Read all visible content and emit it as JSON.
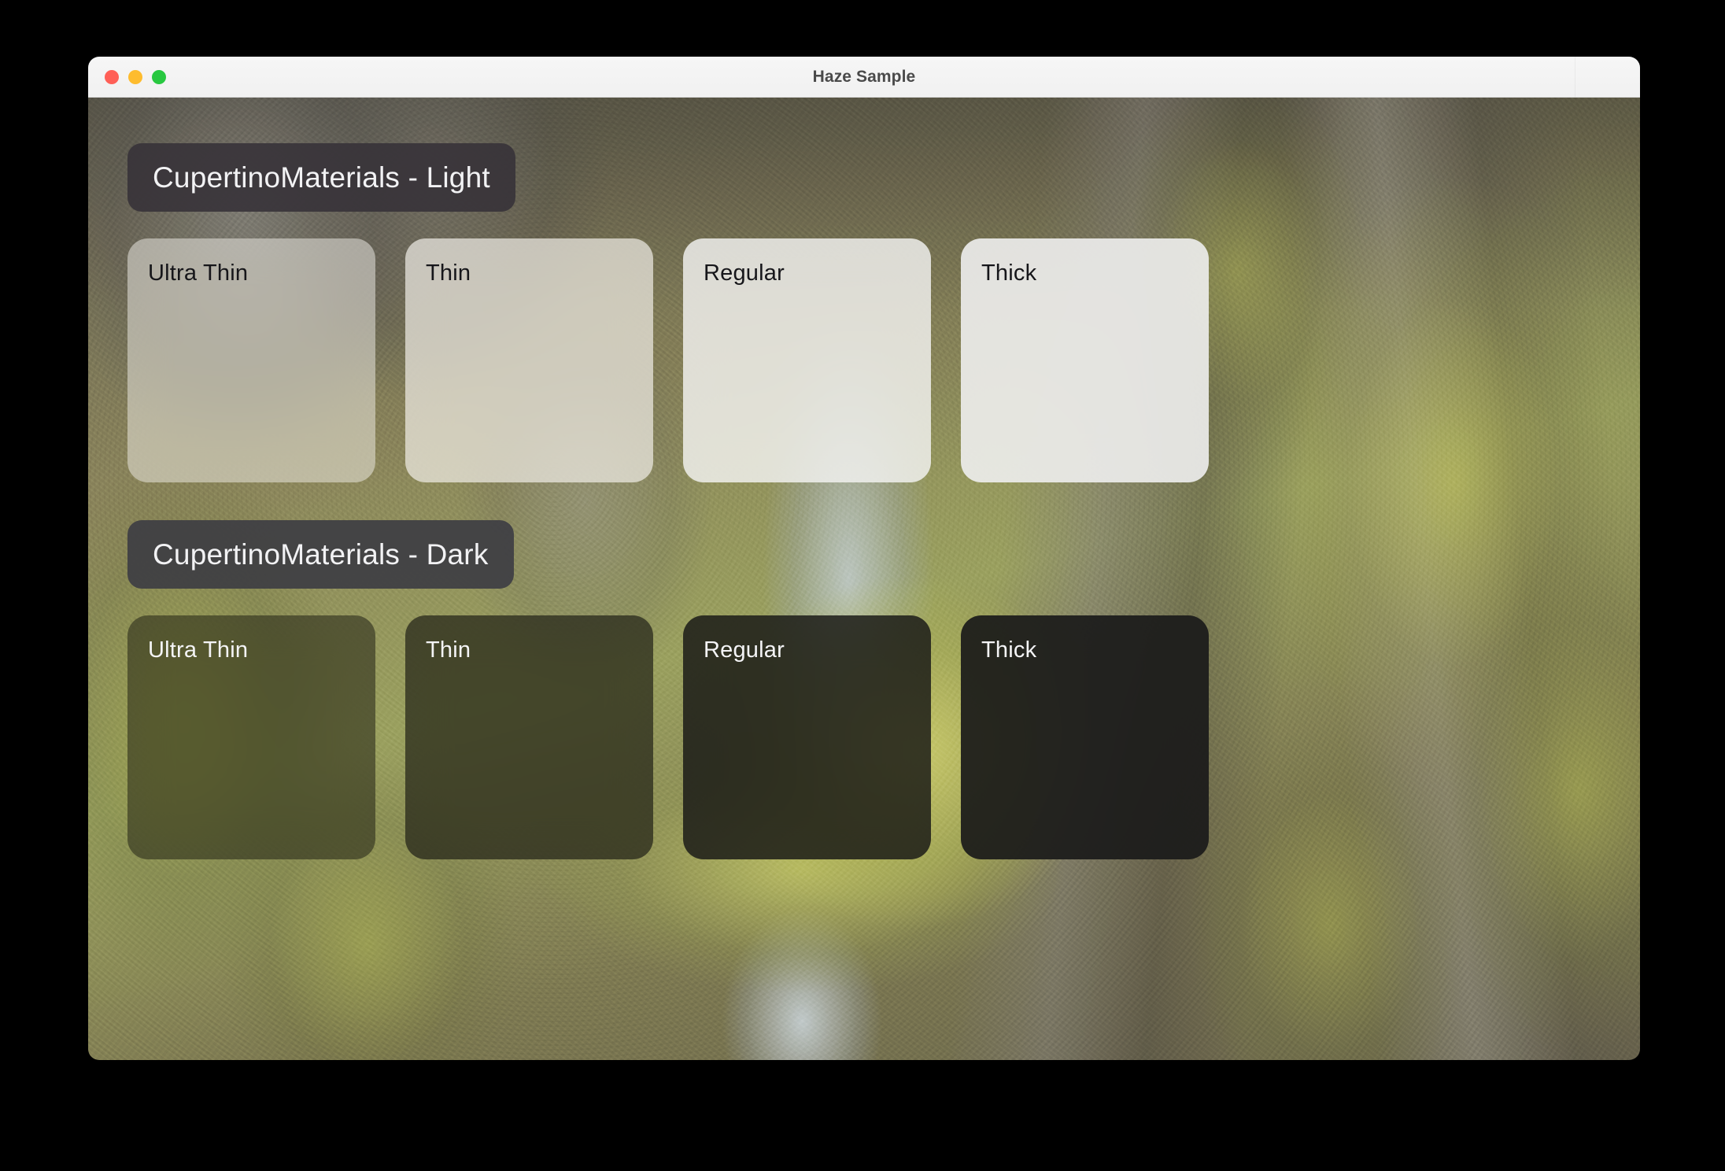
{
  "window": {
    "title": "Haze Sample",
    "traffic_lights": [
      {
        "name": "close",
        "color": "#ff5f57"
      },
      {
        "name": "minimize",
        "color": "#febc2e"
      },
      {
        "name": "maximize",
        "color": "#28c840"
      }
    ]
  },
  "background": {
    "description": "Photograph of a mossy Icelandic canyon with grey basalt cliffs and yellow-green moss"
  },
  "sections": [
    {
      "id": "light",
      "header": "CupertinoMaterials - Light",
      "header_bg": "#363138",
      "header_text_color": "#f2f2f4",
      "label_color": "#16161a",
      "cards": [
        {
          "label": "Ultra Thin",
          "variant": "m-light-ultrathin"
        },
        {
          "label": "Thin",
          "variant": "m-light-thin"
        },
        {
          "label": "Regular",
          "variant": "m-light-regular"
        },
        {
          "label": "Thick",
          "variant": "m-light-thick"
        }
      ]
    },
    {
      "id": "dark",
      "header": "CupertinoMaterials - Dark",
      "header_bg": "#3c3c44",
      "header_text_color": "#f2f2f4",
      "label_color": "#f4f4f6",
      "cards": [
        {
          "label": "Ultra Thin",
          "variant": "m-dark-ultrathin"
        },
        {
          "label": "Thin",
          "variant": "m-dark-thin"
        },
        {
          "label": "Regular",
          "variant": "m-dark-regular"
        },
        {
          "label": "Thick",
          "variant": "m-dark-thick"
        }
      ]
    }
  ]
}
